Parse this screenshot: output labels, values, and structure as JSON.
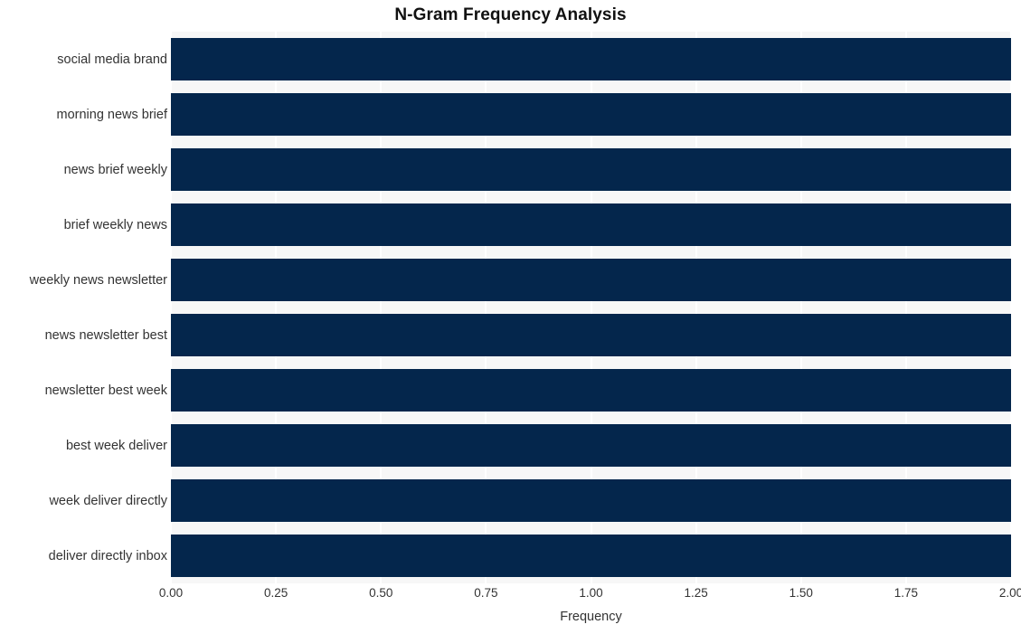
{
  "chart_data": {
    "type": "bar",
    "orientation": "horizontal",
    "title": "N-Gram Frequency Analysis",
    "xlabel": "Frequency",
    "ylabel": "",
    "categories": [
      "social media brand",
      "morning news brief",
      "news brief weekly",
      "brief weekly news",
      "weekly news newsletter",
      "news newsletter best",
      "newsletter best week",
      "best week deliver",
      "week deliver directly",
      "deliver directly inbox"
    ],
    "values": [
      2,
      2,
      2,
      2,
      2,
      2,
      2,
      2,
      2,
      2
    ],
    "xlim": [
      0.0,
      2.0
    ],
    "xticks": [
      0.0,
      0.25,
      0.5,
      0.75,
      1.0,
      1.25,
      1.5,
      1.75,
      2.0
    ],
    "xtick_labels": [
      "0.00",
      "0.25",
      "0.50",
      "0.75",
      "1.00",
      "1.25",
      "1.50",
      "1.75",
      "2.00"
    ],
    "grid": true,
    "grid_axis": "x",
    "legend": false,
    "bar_color": "#04264c",
    "plot_background": "#f7f7f7",
    "gridline_color": "#ffffff",
    "figure_background": "#ffffff",
    "text_color": "#333333"
  }
}
